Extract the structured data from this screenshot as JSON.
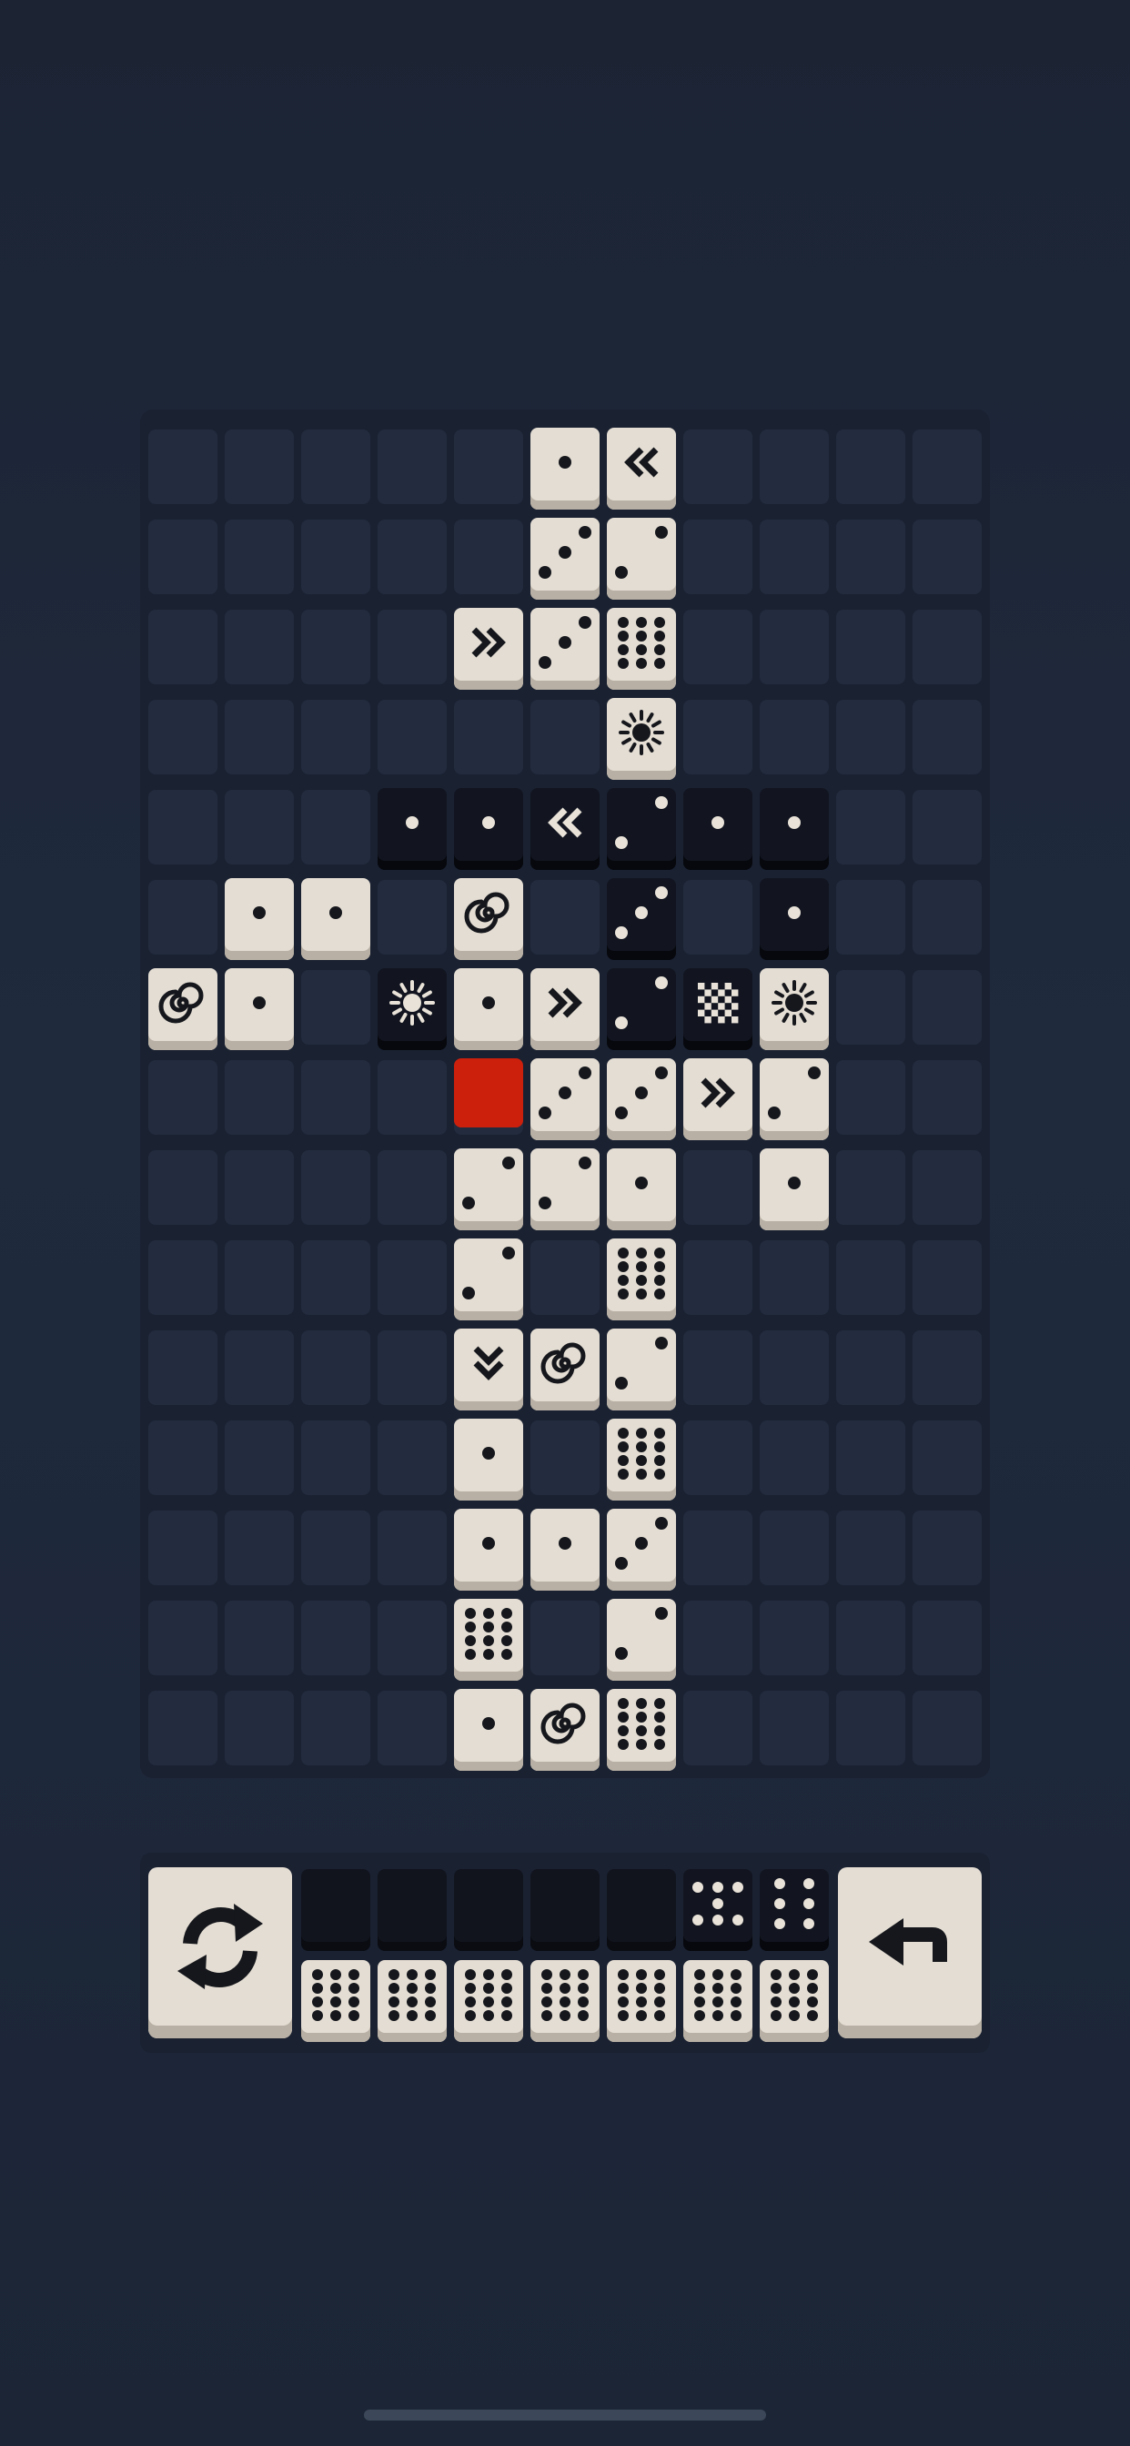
{
  "board": {
    "columns": 11,
    "rows": 15,
    "tiles": [
      {
        "col": 5,
        "row": 0,
        "color": "white",
        "face": "one"
      },
      {
        "col": 6,
        "row": 0,
        "color": "white",
        "face": "arrow-left-icon"
      },
      {
        "col": 5,
        "row": 1,
        "color": "white",
        "face": "three"
      },
      {
        "col": 6,
        "row": 1,
        "color": "white",
        "face": "two"
      },
      {
        "col": 4,
        "row": 2,
        "color": "white",
        "face": "arrow-right-icon"
      },
      {
        "col": 5,
        "row": 2,
        "color": "white",
        "face": "three"
      },
      {
        "col": 6,
        "row": 2,
        "color": "white",
        "face": "twelve"
      },
      {
        "col": 6,
        "row": 3,
        "color": "white",
        "face": "sun-icon"
      },
      {
        "col": 3,
        "row": 4,
        "color": "black",
        "face": "one"
      },
      {
        "col": 4,
        "row": 4,
        "color": "black",
        "face": "one"
      },
      {
        "col": 5,
        "row": 4,
        "color": "black",
        "face": "arrow-left-icon"
      },
      {
        "col": 6,
        "row": 4,
        "color": "black",
        "face": "two"
      },
      {
        "col": 7,
        "row": 4,
        "color": "black",
        "face": "one"
      },
      {
        "col": 8,
        "row": 4,
        "color": "black",
        "face": "one"
      },
      {
        "col": 1,
        "row": 5,
        "color": "white",
        "face": "one"
      },
      {
        "col": 2,
        "row": 5,
        "color": "white",
        "face": "one"
      },
      {
        "col": 4,
        "row": 5,
        "color": "white",
        "face": "spiral-icon"
      },
      {
        "col": 6,
        "row": 5,
        "color": "black",
        "face": "three"
      },
      {
        "col": 8,
        "row": 5,
        "color": "black",
        "face": "one"
      },
      {
        "col": 0,
        "row": 6,
        "color": "white",
        "face": "spiral-icon"
      },
      {
        "col": 1,
        "row": 6,
        "color": "white",
        "face": "one"
      },
      {
        "col": 3,
        "row": 6,
        "color": "black",
        "face": "sun-icon"
      },
      {
        "col": 4,
        "row": 6,
        "color": "white",
        "face": "one"
      },
      {
        "col": 5,
        "row": 6,
        "color": "white",
        "face": "arrow-right-icon"
      },
      {
        "col": 6,
        "row": 6,
        "color": "black",
        "face": "two"
      },
      {
        "col": 7,
        "row": 6,
        "color": "black",
        "face": "checker-icon"
      },
      {
        "col": 8,
        "row": 6,
        "color": "white",
        "face": "sun-icon"
      },
      {
        "col": 4,
        "row": 7,
        "color": "red",
        "face": "blank"
      },
      {
        "col": 5,
        "row": 7,
        "color": "white",
        "face": "three"
      },
      {
        "col": 6,
        "row": 7,
        "color": "white",
        "face": "three"
      },
      {
        "col": 7,
        "row": 7,
        "color": "white",
        "face": "arrow-right-icon"
      },
      {
        "col": 8,
        "row": 7,
        "color": "white",
        "face": "two"
      },
      {
        "col": 4,
        "row": 8,
        "color": "white",
        "face": "two"
      },
      {
        "col": 5,
        "row": 8,
        "color": "white",
        "face": "two"
      },
      {
        "col": 6,
        "row": 8,
        "color": "white",
        "face": "one"
      },
      {
        "col": 8,
        "row": 8,
        "color": "white",
        "face": "one"
      },
      {
        "col": 4,
        "row": 9,
        "color": "white",
        "face": "two"
      },
      {
        "col": 6,
        "row": 9,
        "color": "white",
        "face": "twelve"
      },
      {
        "col": 4,
        "row": 10,
        "color": "white",
        "face": "arrow-down-icon"
      },
      {
        "col": 5,
        "row": 10,
        "color": "white",
        "face": "spiral-icon"
      },
      {
        "col": 6,
        "row": 10,
        "color": "white",
        "face": "two"
      },
      {
        "col": 4,
        "row": 11,
        "color": "white",
        "face": "one"
      },
      {
        "col": 6,
        "row": 11,
        "color": "white",
        "face": "twelve"
      },
      {
        "col": 4,
        "row": 12,
        "color": "white",
        "face": "one"
      },
      {
        "col": 5,
        "row": 12,
        "color": "white",
        "face": "one"
      },
      {
        "col": 6,
        "row": 12,
        "color": "white",
        "face": "three"
      },
      {
        "col": 6,
        "row": 13,
        "color": "white",
        "face": "two"
      },
      {
        "col": 4,
        "row": 13,
        "color": "white",
        "face": "twelve"
      },
      {
        "col": 4,
        "row": 14,
        "color": "white",
        "face": "one"
      },
      {
        "col": 5,
        "row": 14,
        "color": "white",
        "face": "spiral-icon"
      },
      {
        "col": 6,
        "row": 14,
        "color": "white",
        "face": "twelve"
      }
    ]
  },
  "tray": {
    "left_button_icon": "refresh-icon",
    "right_button_icon": "undo-arrow-icon",
    "top_row": [
      "empty",
      "empty",
      "empty",
      "empty",
      "empty",
      "seven",
      "six"
    ],
    "bottom_row": [
      "twelve",
      "twelve",
      "twelve",
      "twelve",
      "twelve",
      "twelve",
      "twelve"
    ]
  },
  "colors": {
    "background": "#1f2a3d",
    "tile_white": "#e4ddd3",
    "tile_black": "#121520",
    "tile_red": "#cc200d",
    "empty_cell": "#222c3e"
  }
}
